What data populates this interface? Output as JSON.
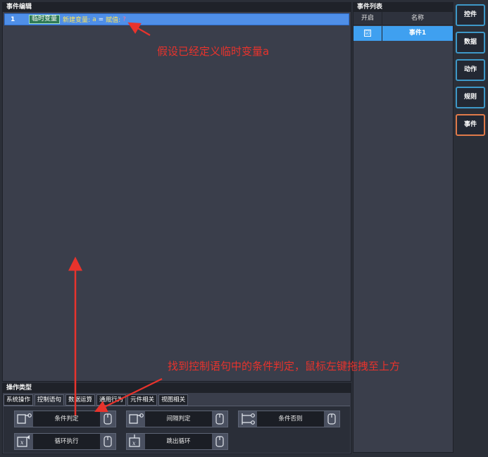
{
  "editor": {
    "title": "事件编辑",
    "row": {
      "number": "1",
      "tag": "临时变量",
      "new_var": "新建变量:",
      "new_var_value": "a",
      "equals": "=",
      "assign": "赋值:",
      "assign_value": "?"
    }
  },
  "event_list": {
    "title": "事件列表",
    "col_enabled": "开启",
    "col_name": "名称",
    "rows": [
      {
        "checked": "☑",
        "name": "事件1"
      }
    ]
  },
  "sidebar": {
    "items": [
      {
        "label": "控件"
      },
      {
        "label": "数据"
      },
      {
        "label": "动作"
      },
      {
        "label": "规则"
      },
      {
        "label": "事件",
        "active": true
      }
    ]
  },
  "ops": {
    "title": "操作类型",
    "tabs": [
      "系统操作",
      "控制语句",
      "数据运算",
      "通用行为",
      "元件相关",
      "视图相关"
    ],
    "active_tab": "控制语句",
    "items": [
      {
        "label": "条件判定",
        "icon": "branch-icon"
      },
      {
        "label": "间隔判定",
        "icon": "branch-icon"
      },
      {
        "label": "条件否则",
        "icon": "branch-else-icon"
      },
      {
        "label": "循环执行",
        "icon": "loop-icon"
      },
      {
        "label": "跳出循环",
        "icon": "break-loop-icon"
      }
    ]
  },
  "annotations": {
    "top": "假设已经定义临时变量a",
    "bottom": "找到控制语句中的条件判定，鼠标左键拖拽至上方"
  },
  "colors": {
    "accent_blue": "#3fa0f0",
    "active_orange": "#e07a4a",
    "annotation_red": "#e8332c"
  }
}
